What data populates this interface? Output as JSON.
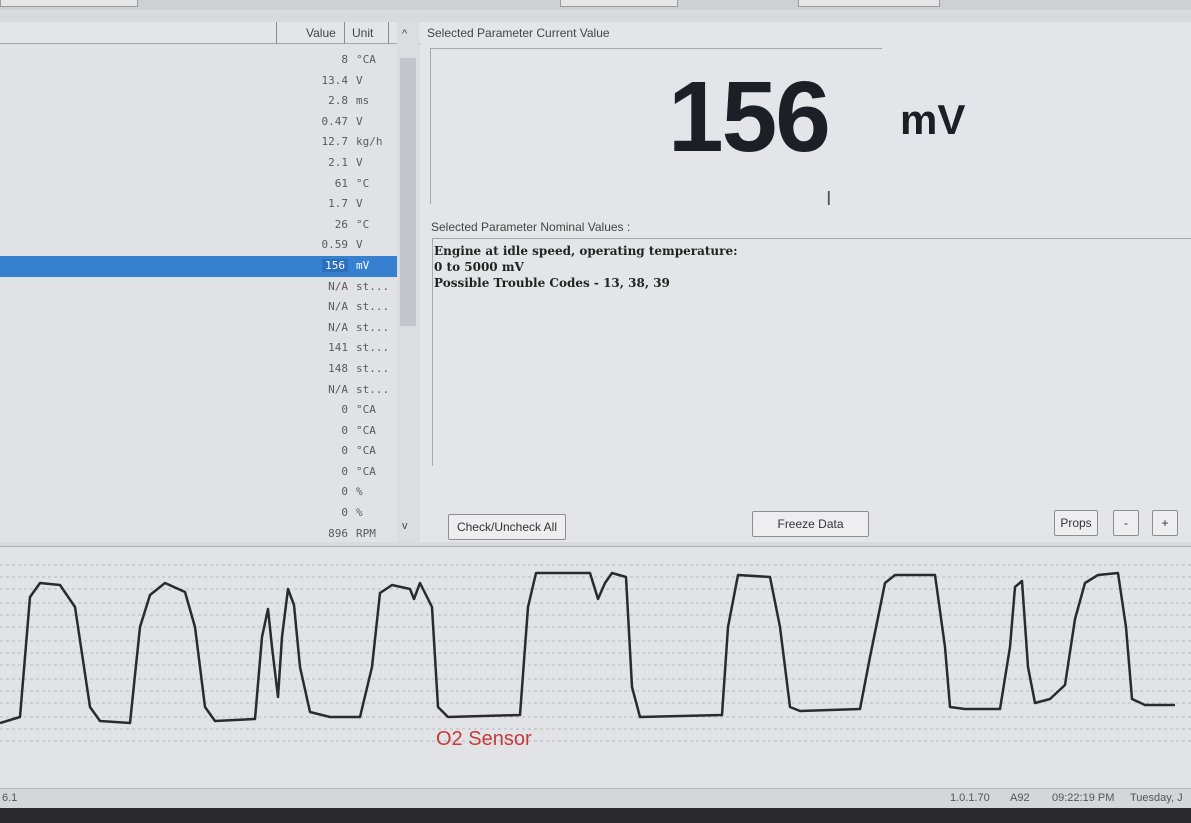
{
  "table": {
    "header_value": "Value",
    "header_unit": "Unit",
    "rows": [
      {
        "value": "8",
        "unit": "°CA"
      },
      {
        "value": "13.4",
        "unit": "V"
      },
      {
        "value": "2.8",
        "unit": "ms"
      },
      {
        "value": "0.47",
        "unit": "V"
      },
      {
        "value": "12.7",
        "unit": "kg/h"
      },
      {
        "value": "2.1",
        "unit": "V"
      },
      {
        "value": "61",
        "unit": "°C"
      },
      {
        "value": "1.7",
        "unit": "V"
      },
      {
        "value": "26",
        "unit": "°C"
      },
      {
        "value": "0.59",
        "unit": "V"
      },
      {
        "value": "156",
        "unit": "mV"
      },
      {
        "value": "N/A",
        "unit": "st..."
      },
      {
        "value": "N/A",
        "unit": "st..."
      },
      {
        "value": "N/A",
        "unit": "st..."
      },
      {
        "value": "141",
        "unit": "st..."
      },
      {
        "value": "148",
        "unit": "st..."
      },
      {
        "value": "N/A",
        "unit": "st..."
      },
      {
        "value": "0",
        "unit": "°CA"
      },
      {
        "value": "0",
        "unit": "°CA"
      },
      {
        "value": "0",
        "unit": "°CA"
      },
      {
        "value": "0",
        "unit": "°CA"
      },
      {
        "value": "0",
        "unit": "%"
      },
      {
        "value": "0",
        "unit": "%"
      },
      {
        "value": "896",
        "unit": "RPM"
      }
    ],
    "selected_index": 10,
    "scroll_up_glyph": "^",
    "scroll_down_glyph": "v"
  },
  "current": {
    "label": "Selected Parameter Current Value",
    "value": "156",
    "unit": "mV"
  },
  "nominal": {
    "label": "Selected Parameter Nominal Values :",
    "lines": [
      "Engine at idle speed, operating temperature:",
      "0 to 5000 mV",
      "Possible Trouble Codes - 13, 38, 39"
    ]
  },
  "buttons": {
    "check_all": "Check/Uncheck All",
    "freeze": "Freeze Data",
    "props": "Props",
    "minus": "-",
    "plus": "+"
  },
  "chart_data": {
    "type": "line",
    "title": "O2 Sensor",
    "series_color": "#2b2b2e"
  },
  "status": {
    "left": "6.1",
    "version": "1.0.1.70",
    "code": "A92",
    "time": "09:22:19 PM",
    "day": "Tuesday, J"
  },
  "icons": {
    "text_cursor": "I"
  }
}
